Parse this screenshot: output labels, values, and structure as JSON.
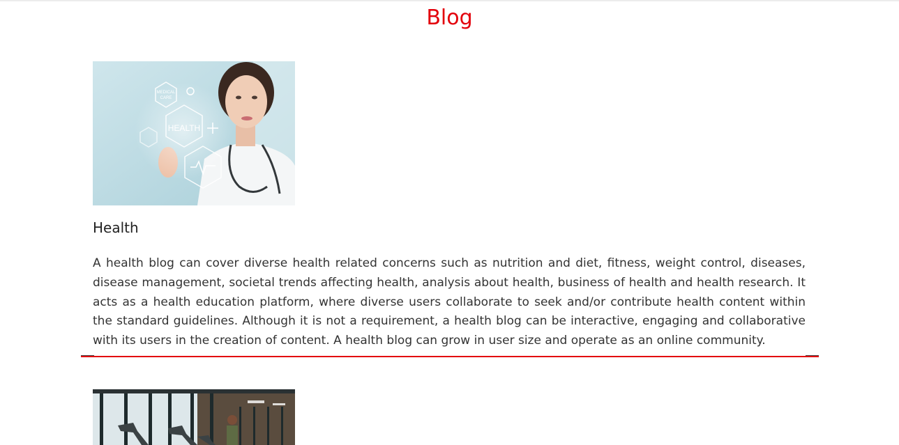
{
  "page": {
    "title": "Blog"
  },
  "posts": [
    {
      "title": "Health",
      "body": "A health blog can cover diverse health related concerns such as nutrition and diet, fitness, weight control, diseases, disease management, societal trends affecting health, analysis about health, business of health and health research. It acts as a health education platform, where diverse users collaborate to seek and/or contribute health content within the standard guidelines. Although it is not a requirement, a health blog can be interactive, engaging and collaborative with its users in the creation of content. A health blog can grow in user size and operate as an online community.",
      "image_labels": {
        "main": "HEALTH",
        "care_line1": "MEDICAL",
        "care_line2": "CARE"
      }
    },
    {
      "title": "",
      "body": ""
    }
  ],
  "colors": {
    "accent": "#e3000b",
    "text": "#333333",
    "heading": "#222222"
  },
  "icons": [
    "medical-care-hexagon-icon",
    "wheelchair-icon",
    "plus-icon",
    "heart-pulse-icon"
  ]
}
